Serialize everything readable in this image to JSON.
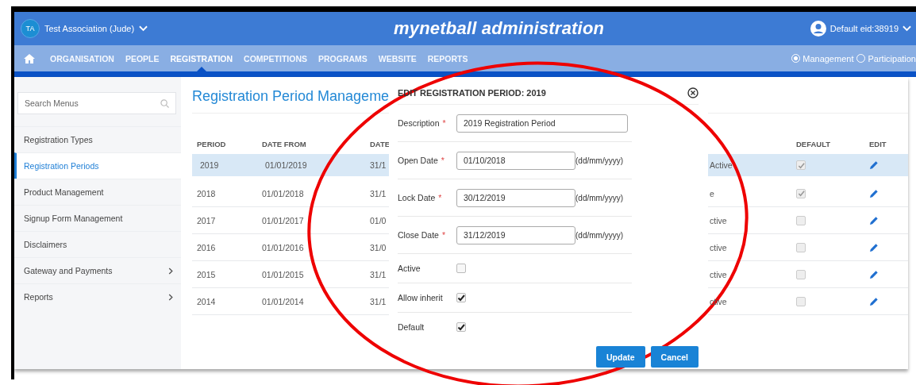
{
  "header": {
    "org_initials": "TA",
    "org_name": "Test Association (Jude)",
    "title": "mynetball administration",
    "user": "Default eid:38919"
  },
  "nav": {
    "items": [
      {
        "label": "ORGANISATION",
        "selected": false
      },
      {
        "label": "PEOPLE",
        "selected": false
      },
      {
        "label": "REGISTRATION",
        "selected": true
      },
      {
        "label": "COMPETITIONS",
        "selected": false
      },
      {
        "label": "PROGRAMS",
        "selected": false
      },
      {
        "label": "WEBSITE",
        "selected": false
      },
      {
        "label": "REPORTS",
        "selected": false
      }
    ],
    "modes": [
      {
        "label": "Management",
        "selected": true
      },
      {
        "label": "Participation",
        "selected": false
      }
    ]
  },
  "sidebar": {
    "search": {
      "placeholder": "Search Menus"
    },
    "items": [
      {
        "label": "Registration Types",
        "selected": false,
        "has_submenu": false
      },
      {
        "label": "Registration Periods",
        "selected": true,
        "has_submenu": false
      },
      {
        "label": "Product Management",
        "selected": false,
        "has_submenu": false
      },
      {
        "label": "Signup Form Management",
        "selected": false,
        "has_submenu": false
      },
      {
        "label": "Disclaimers",
        "selected": false,
        "has_submenu": false
      },
      {
        "label": "Gateway and Payments",
        "selected": false,
        "has_submenu": true
      },
      {
        "label": "Reports",
        "selected": false,
        "has_submenu": true
      }
    ]
  },
  "page": {
    "title": "Registration Period Manageme",
    "table": {
      "columns": [
        "PERIOD",
        "DATE FROM",
        "DATE",
        "DEFAULT",
        "EDIT"
      ],
      "rows": [
        {
          "period": "2019",
          "date_from": "01/01/2019",
          "date_to": "31/1",
          "status": "Active",
          "default": true,
          "selected": true
        },
        {
          "period": "2018",
          "date_from": "01/01/2018",
          "date_to": "31/1",
          "status": "e",
          "default": true,
          "selected": false
        },
        {
          "period": "2017",
          "date_from": "01/01/2017",
          "date_to": "01/0",
          "status": "ctive",
          "default": false,
          "selected": false
        },
        {
          "period": "2016",
          "date_from": "01/01/2016",
          "date_to": "31/0",
          "status": "ctive",
          "default": false,
          "selected": false
        },
        {
          "period": "2015",
          "date_from": "01/01/2015",
          "date_to": "31/1",
          "status": "ctive",
          "default": false,
          "selected": false
        },
        {
          "period": "2014",
          "date_from": "01/01/2014",
          "date_to": "31/1",
          "status": "ctive",
          "default": false,
          "selected": false
        }
      ]
    }
  },
  "dialog": {
    "title": "EDIT REGISTRATION PERIOD: 2019",
    "fields": [
      {
        "kind": "text",
        "label": "Description",
        "required_mark": "*",
        "value": "2019 Registration Period"
      },
      {
        "kind": "date",
        "label": "Open Date",
        "required_mark": "*",
        "value": "01/10/2018",
        "hint": "(dd/mm/yyyy)"
      },
      {
        "kind": "date",
        "label": "Lock Date",
        "required_mark": "*",
        "value": "30/12/2019",
        "hint": "(dd/mm/yyyy)"
      },
      {
        "kind": "date",
        "label": "Close Date",
        "required_mark": "*",
        "value": "31/12/2019",
        "hint": "(dd/mm/yyyy)"
      },
      {
        "kind": "checkbox",
        "label": "Active",
        "checked": false
      },
      {
        "kind": "checkbox",
        "label": "Allow inherit",
        "checked": true
      },
      {
        "kind": "checkbox",
        "label": "Default",
        "checked": true
      }
    ],
    "buttons": [
      "Update",
      "Cancel"
    ]
  }
}
